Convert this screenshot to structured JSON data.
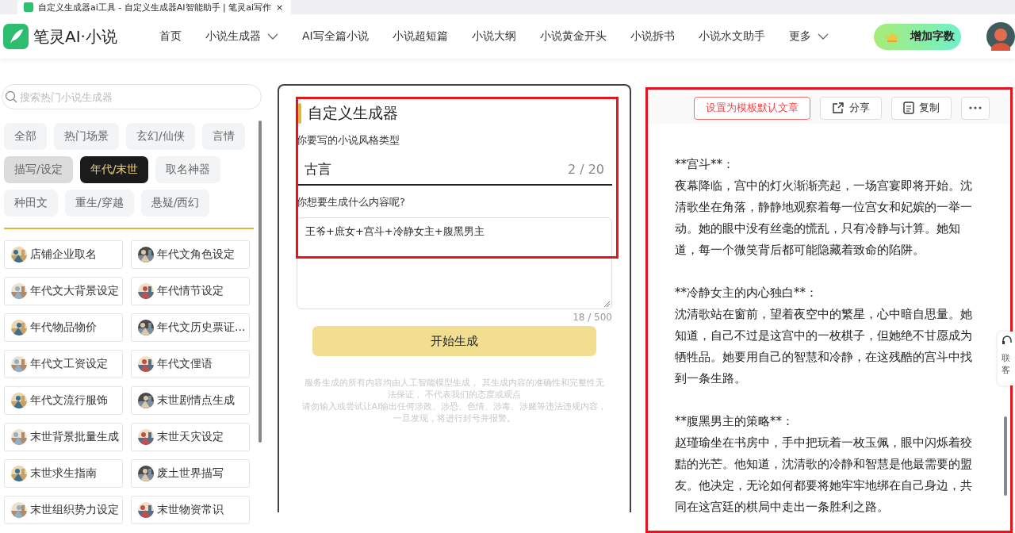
{
  "browser_tab": {
    "title": "自定义生成器ai工具 - 自定义生成器AI智能助手 | 笔灵ai写作",
    "close": "×"
  },
  "nav": {
    "logo": "笔灵AI·小说",
    "items": [
      {
        "label": "首页",
        "dropdown": false
      },
      {
        "label": "小说生成器",
        "dropdown": true
      },
      {
        "label": "AI写全篇小说",
        "dropdown": false
      },
      {
        "label": "小说超短篇",
        "dropdown": false
      },
      {
        "label": "小说大纲",
        "dropdown": false
      },
      {
        "label": "小说黄金开头",
        "dropdown": false
      },
      {
        "label": "小说拆书",
        "dropdown": false
      },
      {
        "label": "小说水文助手",
        "dropdown": false
      },
      {
        "label": "更多",
        "dropdown": true
      }
    ],
    "upgrade_button": "增加字数"
  },
  "sidebar": {
    "search": {
      "placeholder": "搜索热门小说生成器"
    },
    "categories": [
      {
        "label": "全部",
        "selected": false,
        "hovered": false
      },
      {
        "label": "热门场景",
        "selected": false,
        "hovered": false
      },
      {
        "label": "玄幻/仙侠",
        "selected": false,
        "hovered": false
      },
      {
        "label": "言情",
        "selected": false,
        "hovered": false
      },
      {
        "label": "描写/设定",
        "selected": false,
        "hovered": true
      },
      {
        "label": "年代/末世",
        "selected": true,
        "hovered": false
      },
      {
        "label": "取名神器",
        "selected": false,
        "hovered": false
      },
      {
        "label": "种田文",
        "selected": false,
        "hovered": false
      },
      {
        "label": "重生/穿越",
        "selected": false,
        "hovered": false
      },
      {
        "label": "悬疑/西幻",
        "selected": false,
        "hovered": false
      }
    ],
    "tools": [
      {
        "label": "店铺企业取名"
      },
      {
        "label": "年代文角色设定"
      },
      {
        "label": "年代文大背景设定"
      },
      {
        "label": "年代情节设定"
      },
      {
        "label": "年代物品物价"
      },
      {
        "label": "年代文历史票证..."
      },
      {
        "label": "年代文工资设定"
      },
      {
        "label": "年代文俚语"
      },
      {
        "label": "年代文流行服饰"
      },
      {
        "label": "末世剧情点生成"
      },
      {
        "label": "末世背景批量生成"
      },
      {
        "label": "末世天灾设定"
      },
      {
        "label": "末世求生指南"
      },
      {
        "label": "废土世界描写"
      },
      {
        "label": "末世组织势力设定"
      },
      {
        "label": "末世物资常识"
      }
    ]
  },
  "form": {
    "title": "自定义生成器",
    "highlighted": true,
    "style_label": "你要写的小说风格类型",
    "style_value": "古言",
    "style_count": "2 / 20",
    "content_label": "你想要生成什么内容呢?",
    "content_value": "王爷+庶女+宫斗+冷静女主+腹黑男主",
    "content_count": "18 / 500",
    "submit": "开始生成",
    "disclaimer": [
      "服务生成的所有内容均由人工智能模型生成， 其生成内容的准确性和完整性无法保证， 不代表我们的态度或观点",
      "请勿输入或尝试让AI输出任何涉政、涉恐、色情、涉毒、涉赌等违法违规内容，一旦发现，将进行封号并报警。"
    ]
  },
  "result": {
    "highlighted": true,
    "toolbar": [
      {
        "kind": "outline",
        "label": "设置为模板默认文章"
      },
      {
        "kind": "share",
        "label": "分享"
      },
      {
        "kind": "copy",
        "label": "复制"
      },
      {
        "kind": "more"
      }
    ],
    "paragraphs": [
      {
        "heading": "**宫斗**：",
        "body": "夜幕降临，宫中的灯火渐渐亮起，一场宫宴即将开始。沈清歌坐在角落，静静地观察着每一位宫女和妃嫔的一举一动。她的眼中没有丝毫的慌乱，只有冷静与计算。她知道，每一个微笑背后都可能隐藏着致命的陷阱。"
      },
      {
        "heading": "**冷静女主的内心独白**：",
        "body": "沈清歌站在窗前，望着夜空中的繁星，心中暗自思量。她知道，自己不过是这宫中的一枚棋子，但她绝不甘愿成为牺牲品。她要用自己的智慧和冷静，在这残酷的宫斗中找到一条生路。"
      },
      {
        "heading": "**腹黑男主的策略**：",
        "body": "赵瑾瑜坐在书房中，手中把玩着一枚玉佩，眼中闪烁着狡黠的光芒。他知道，沈清歌的冷静和智慧是他最需要的盟友。他决定，无论如何都要将她牢牢地绑在自己身边，共同在这宫廷的棋局中走出一条胜利之路。"
      }
    ]
  },
  "contact_widget": {
    "lines": [
      "联",
      "客"
    ]
  }
}
